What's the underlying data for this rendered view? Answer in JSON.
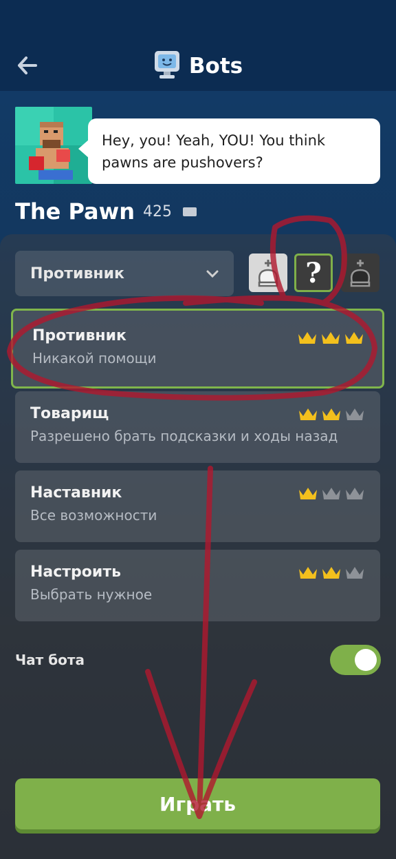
{
  "header": {
    "title": "Bots",
    "back_icon": "arrow-left-icon",
    "title_icon": "bot-monitor-icon"
  },
  "bot": {
    "name": "The Pawn",
    "rating": "425",
    "speech": "Hey, you! Yeah, YOU! You think pawns are pushovers?",
    "flag_icon": "flag-icon"
  },
  "mode_select": {
    "value": "Противник",
    "icon": "chevron-down-icon"
  },
  "color_choice": {
    "options": [
      "white-king-icon",
      "random-question-icon",
      "black-king-icon"
    ],
    "selected": "random-question-icon",
    "random_glyph": "?"
  },
  "modes": [
    {
      "title": "Противник",
      "subtitle": "Никакой помощи",
      "crowns": 3,
      "selected": true
    },
    {
      "title": "Товарищ",
      "subtitle": "Разрешено брать подсказки и ходы назад",
      "crowns": 2,
      "selected": false
    },
    {
      "title": "Наставник",
      "subtitle": "Все возможности",
      "crowns": 1,
      "selected": false
    },
    {
      "title": "Настроить",
      "subtitle": "Выбрать нужное",
      "crowns": 2,
      "selected": false
    }
  ],
  "chat": {
    "label": "Чат бота",
    "enabled": true
  },
  "play_button": {
    "label": "Играть"
  },
  "colors": {
    "accent_green": "#7fb04a",
    "crown_gold": "#f3c01d",
    "crown_gray": "#8e9298",
    "annotation_red": "#b0182e"
  }
}
